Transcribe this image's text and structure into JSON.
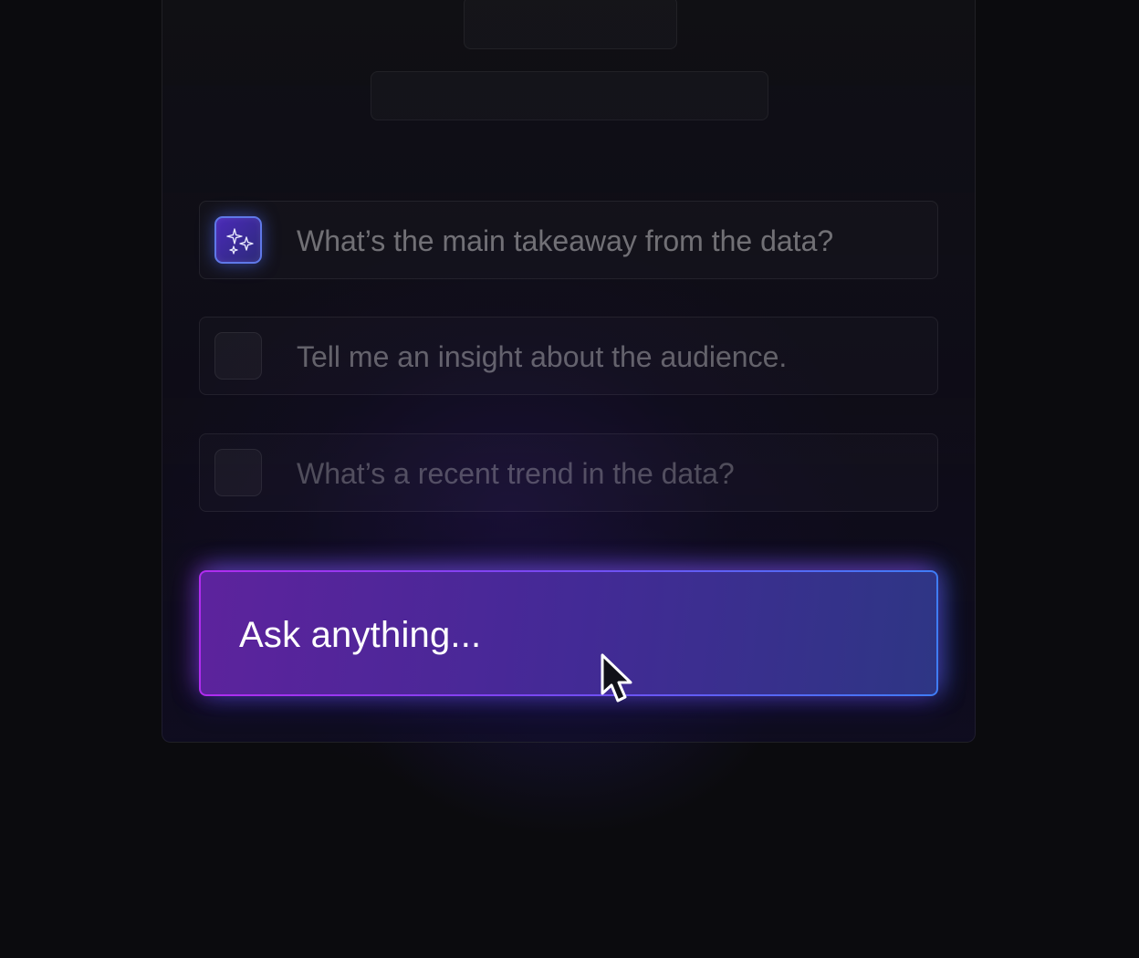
{
  "suggestions": [
    {
      "text": "What’s the main takeaway from the data?"
    },
    {
      "text": "Tell me an insight about the audience."
    },
    {
      "text": "What’s a recent trend in the data?"
    }
  ],
  "ask": {
    "placeholder": "Ask anything..."
  },
  "icons": {
    "active_suggestion": "sparkles-icon",
    "pointer": "mouse-pointer-icon"
  },
  "colors": {
    "background": "#0b0b0e",
    "accent_purple": "#b12cf0",
    "accent_blue": "#3f7df7"
  }
}
